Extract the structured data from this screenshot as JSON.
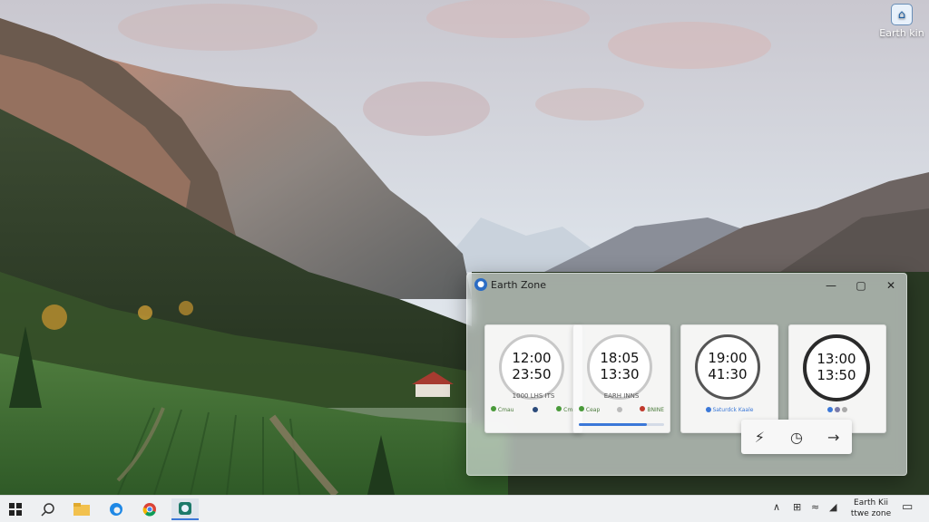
{
  "desktop": {
    "icon_label": "Earth kin"
  },
  "window": {
    "title": "Earth Zone",
    "controls": {
      "minimize": "—",
      "maximize": "▢",
      "close": "✕"
    }
  },
  "cards": [
    {
      "time1": "12:00",
      "time2": "23:50",
      "label": "1000 LHS ITS",
      "status_left": "Cmau",
      "status_right": "Cmu",
      "accent": "#4a9a3a"
    },
    {
      "time1": "18:05",
      "time2": "13:30",
      "label": "EARH INNS",
      "status_left": "Ceap",
      "status_right": "BNINE",
      "progress": 0.8,
      "accent": "#4a9a3a"
    },
    {
      "time1": "19:00",
      "time2": "41:30",
      "label": "",
      "status_left": "Saturdck Kaale",
      "status_right": "",
      "accent": "#3b78d8"
    },
    {
      "time1": "13:00",
      "time2": "13:50",
      "label": "",
      "status_left": "",
      "status_right": "",
      "accent": "#3b78d8"
    }
  ],
  "actions": {
    "bolt": "⚡",
    "clock": "◷",
    "arrow": "→"
  },
  "taskbar": {
    "tray_label_1": "Earth Kii",
    "tray_label_2": "ttwe zone"
  },
  "colors": {
    "accent_blue": "#3b78d8",
    "status_green": "#4a9a3a"
  }
}
